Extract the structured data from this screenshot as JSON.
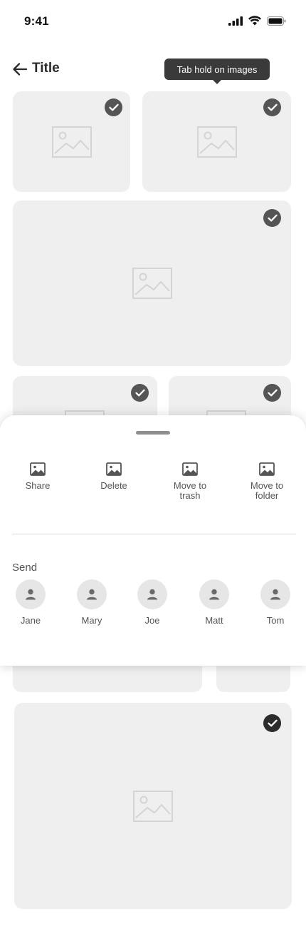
{
  "status_bar": {
    "time": "9:41",
    "icons": [
      "signal-icon",
      "wifi-icon",
      "battery-icon"
    ]
  },
  "header": {
    "title": "Title",
    "back_icon": "arrow-left-icon",
    "tooltip": "Tab hold on images"
  },
  "gallery": {
    "placeholder_icon": "image-placeholder-icon",
    "check_icon": "check-icon",
    "items": [
      {
        "selected": true
      },
      {
        "selected": true
      },
      {
        "selected": true
      },
      {
        "selected": true
      },
      {
        "selected": true
      },
      {
        "selected": true
      }
    ]
  },
  "sheet": {
    "actions": [
      {
        "label": "Share",
        "icon": "image-icon"
      },
      {
        "label": "Delete",
        "icon": "image-icon"
      },
      {
        "label": "Move to trash",
        "icon": "image-icon"
      },
      {
        "label": "Move to folder",
        "icon": "image-icon"
      }
    ],
    "send_label": "Send",
    "contacts": [
      {
        "name": "Jane",
        "icon": "person-icon"
      },
      {
        "name": "Mary",
        "icon": "person-icon"
      },
      {
        "name": "Joe",
        "icon": "person-icon"
      },
      {
        "name": "Matt",
        "icon": "person-icon"
      },
      {
        "name": "Tom",
        "icon": "person-icon"
      }
    ]
  },
  "colors": {
    "tile_bg": "#efefef",
    "check_bg": "#555555",
    "tooltip_bg": "#3a3a3a",
    "text": "#555555"
  }
}
